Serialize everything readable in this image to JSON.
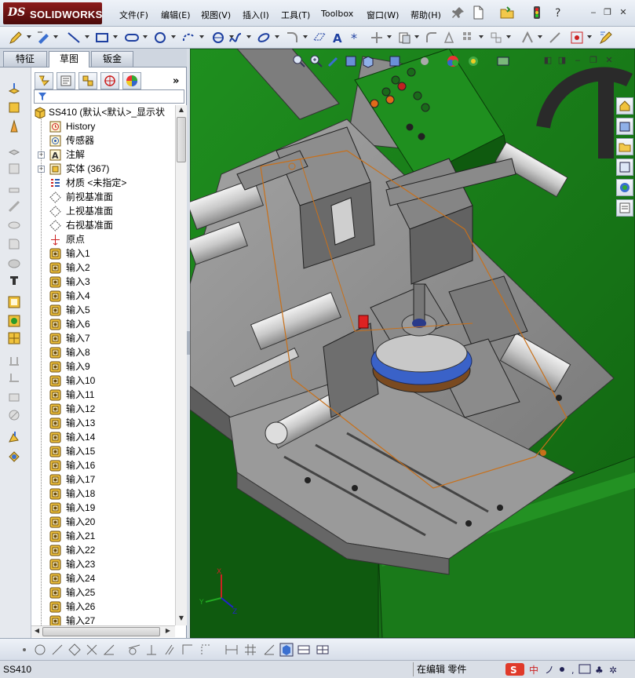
{
  "app": {
    "logo_ds": "DS",
    "logo_name": "SOLIDWORKS",
    "brand_color": "#7a1414"
  },
  "menu": {
    "items": [
      {
        "label": "文件(F)"
      },
      {
        "label": "编辑(E)"
      },
      {
        "label": "视图(V)"
      },
      {
        "label": "插入(I)"
      },
      {
        "label": "工具(T)"
      },
      {
        "label": "Toolbox"
      },
      {
        "label": "窗口(W)"
      },
      {
        "label": "帮助(H)"
      }
    ]
  },
  "tabs": [
    {
      "label": "特征",
      "active": false
    },
    {
      "label": "草图",
      "active": true
    },
    {
      "label": "钣金",
      "active": false
    }
  ],
  "feature_tree": {
    "root": "SS410  (默认<默认>_显示状",
    "items": [
      {
        "label": "History",
        "icon": "history-icon",
        "expandable": false
      },
      {
        "label": "传感器",
        "icon": "sensor-icon",
        "expandable": false
      },
      {
        "label": "注解",
        "icon": "annotation-icon",
        "expandable": true
      },
      {
        "label": "实体 (367)",
        "icon": "solid-bodies-icon",
        "expandable": true
      },
      {
        "label": "材质 <未指定>",
        "icon": "material-icon",
        "expandable": false
      },
      {
        "label": "前视基准面",
        "icon": "plane-icon",
        "expandable": false
      },
      {
        "label": "上视基准面",
        "icon": "plane-icon",
        "expandable": false
      },
      {
        "label": "右视基准面",
        "icon": "plane-icon",
        "expandable": false
      },
      {
        "label": "原点",
        "icon": "origin-icon",
        "expandable": false
      },
      {
        "label": "输入1",
        "icon": "import-icon",
        "expandable": false
      },
      {
        "label": "输入2",
        "icon": "import-icon",
        "expandable": false
      },
      {
        "label": "输入3",
        "icon": "import-icon",
        "expandable": false
      },
      {
        "label": "输入4",
        "icon": "import-icon",
        "expandable": false
      },
      {
        "label": "输入5",
        "icon": "import-icon",
        "expandable": false
      },
      {
        "label": "输入6",
        "icon": "import-icon",
        "expandable": false
      },
      {
        "label": "输入7",
        "icon": "import-icon",
        "expandable": false
      },
      {
        "label": "输入8",
        "icon": "import-icon",
        "expandable": false
      },
      {
        "label": "输入9",
        "icon": "import-icon",
        "expandable": false
      },
      {
        "label": "输入10",
        "icon": "import-icon",
        "expandable": false
      },
      {
        "label": "输入11",
        "icon": "import-icon",
        "expandable": false
      },
      {
        "label": "输入12",
        "icon": "import-icon",
        "expandable": false
      },
      {
        "label": "输入13",
        "icon": "import-icon",
        "expandable": false
      },
      {
        "label": "输入14",
        "icon": "import-icon",
        "expandable": false
      },
      {
        "label": "输入15",
        "icon": "import-icon",
        "expandable": false
      },
      {
        "label": "输入16",
        "icon": "import-icon",
        "expandable": false
      },
      {
        "label": "输入17",
        "icon": "import-icon",
        "expandable": false
      },
      {
        "label": "输入18",
        "icon": "import-icon",
        "expandable": false
      },
      {
        "label": "输入19",
        "icon": "import-icon",
        "expandable": false
      },
      {
        "label": "输入20",
        "icon": "import-icon",
        "expandable": false
      },
      {
        "label": "输入21",
        "icon": "import-icon",
        "expandable": false
      },
      {
        "label": "输入22",
        "icon": "import-icon",
        "expandable": false
      },
      {
        "label": "输入23",
        "icon": "import-icon",
        "expandable": false
      },
      {
        "label": "输入24",
        "icon": "import-icon",
        "expandable": false
      },
      {
        "label": "输入25",
        "icon": "import-icon",
        "expandable": false
      },
      {
        "label": "输入26",
        "icon": "import-icon",
        "expandable": false
      },
      {
        "label": "输入27",
        "icon": "import-icon",
        "expandable": false
      }
    ]
  },
  "triad": {
    "x": "X",
    "y": "Y",
    "z": "Z"
  },
  "status": {
    "document": "SS410",
    "mode": "在编辑  零件"
  },
  "colors": {
    "machine_base_green": "#1f8a1f",
    "plate_gray": "#8f8f8f",
    "sketch_orange": "#c8701a"
  }
}
